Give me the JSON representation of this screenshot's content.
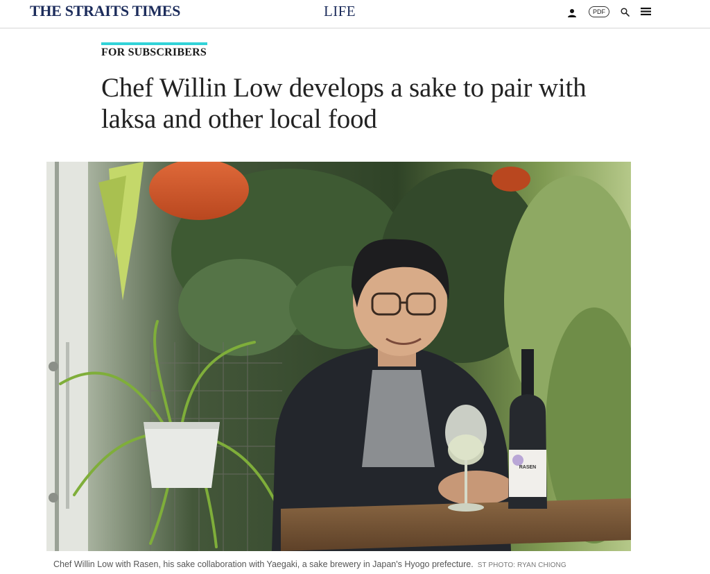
{
  "header": {
    "logo": "THE STRAITS TIMES",
    "section": "LIFE",
    "pdf_label": "PDF",
    "icons": {
      "user": "user-icon",
      "search": "search-icon",
      "menu": "menu-icon"
    }
  },
  "article": {
    "kicker": "FOR SUBSCRIBERS",
    "headline": "Chef Willin Low develops a sake to pair with laksa and other local food",
    "photo": {
      "caption": "Chef Willin Low with Rasen, his sake collaboration with Yaegaki, a sake brewery in Japan's Hyogo prefecture.",
      "credit": "ST PHOTO: RYAN CHIONG",
      "bottle_label": "RASEN"
    }
  },
  "colors": {
    "brand": "#1c2c5b",
    "kicker_accent": "#32d3d8"
  }
}
